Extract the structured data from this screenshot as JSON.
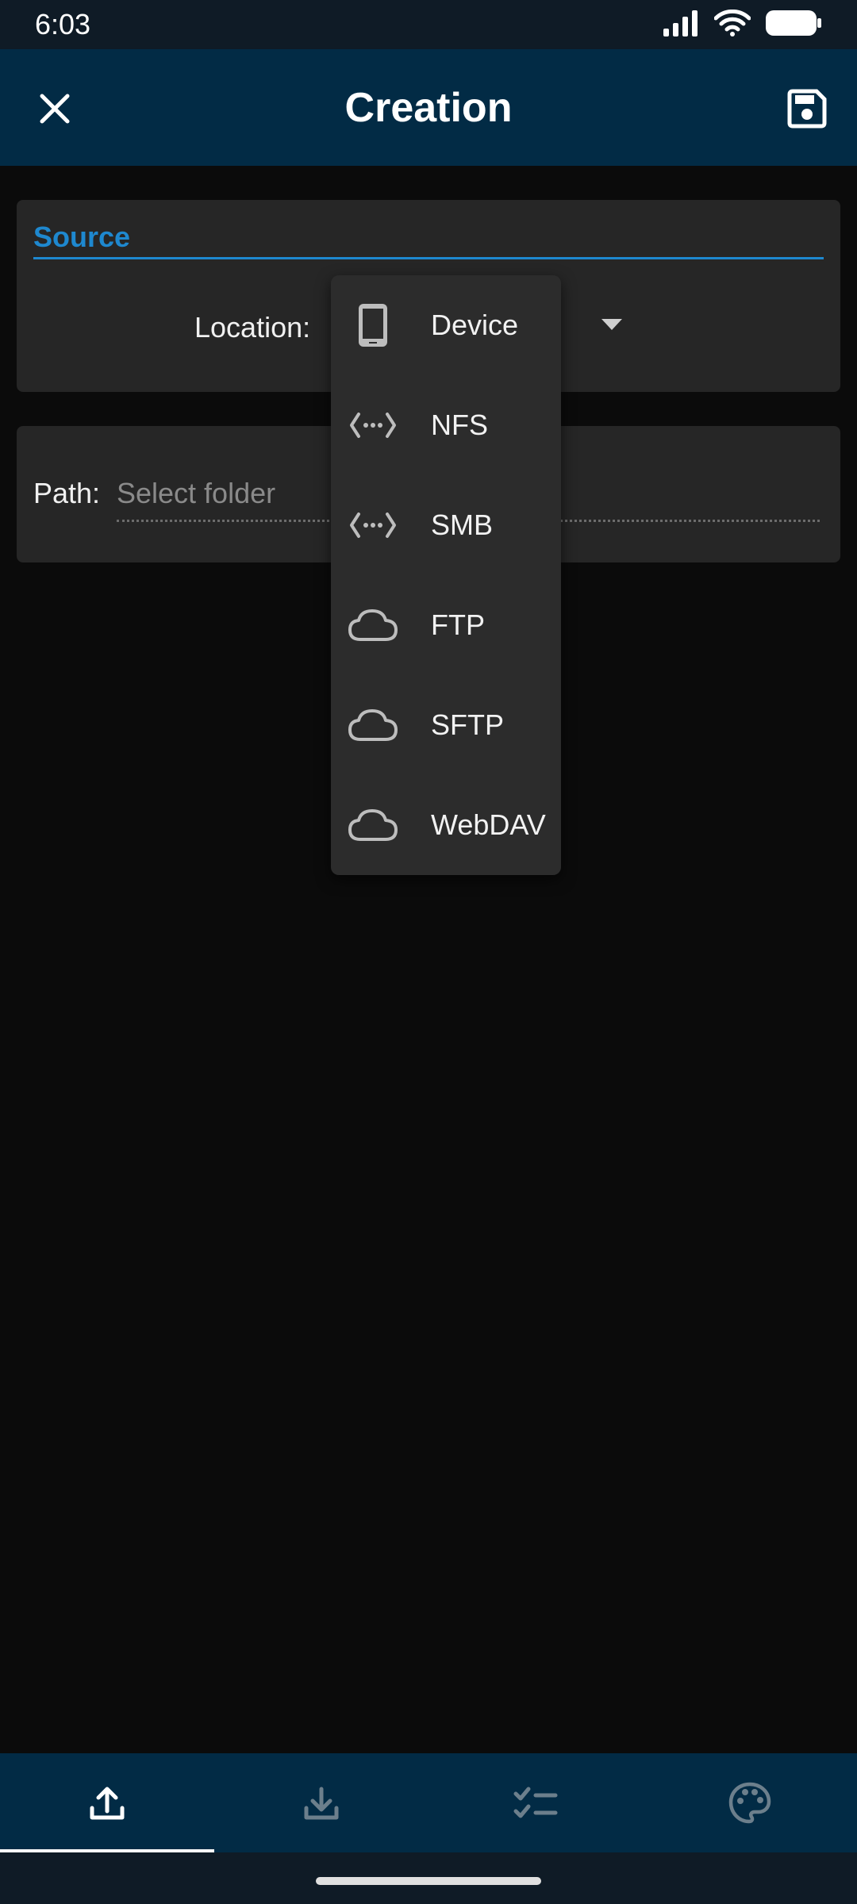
{
  "status_bar": {
    "time": "6:03"
  },
  "app_bar": {
    "title": "Creation"
  },
  "source": {
    "section_label": "Source",
    "location_label": "Location:"
  },
  "path": {
    "label": "Path:",
    "placeholder": "Select folder"
  },
  "location_menu": {
    "items": [
      {
        "label": "Device",
        "icon": "phone-icon"
      },
      {
        "label": "NFS",
        "icon": "network-icon"
      },
      {
        "label": "SMB",
        "icon": "network-icon"
      },
      {
        "label": "FTP",
        "icon": "cloud-icon"
      },
      {
        "label": "SFTP",
        "icon": "cloud-icon"
      },
      {
        "label": "WebDAV",
        "icon": "cloud-icon"
      }
    ]
  },
  "bottom_nav": {
    "items": [
      {
        "icon": "upload-icon",
        "active": true
      },
      {
        "icon": "download-icon",
        "active": false
      },
      {
        "icon": "checklist-icon",
        "active": false
      },
      {
        "icon": "palette-icon",
        "active": false
      }
    ]
  },
  "colors": {
    "accent": "#1e88cf",
    "app_bar": "#022b45",
    "background": "#0b0b0b",
    "card": "#262626"
  }
}
